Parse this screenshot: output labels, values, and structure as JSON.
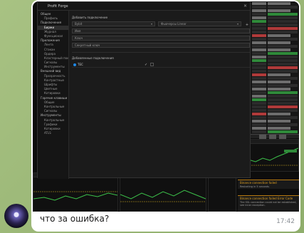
{
  "dialog": {
    "title": "Profit Forge",
    "nav": [
      {
        "label": "Общее",
        "level": 0,
        "active": false
      },
      {
        "label": "Профиль",
        "level": 1,
        "active": false
      },
      {
        "label": "Подключения",
        "level": 0,
        "active": false
      },
      {
        "label": "Биржи",
        "level": 1,
        "active": true
      },
      {
        "label": "Журнал",
        "level": 1,
        "active": false
      },
      {
        "label": "Функционал",
        "level": 1,
        "active": false
      },
      {
        "label": "Приложения",
        "level": 0,
        "active": false
      },
      {
        "label": "Лента",
        "level": 1,
        "active": false
      },
      {
        "label": "Стакан",
        "level": 1,
        "active": false
      },
      {
        "label": "Ордера",
        "level": 1,
        "active": false
      },
      {
        "label": "Кластерный поиск",
        "level": 1,
        "active": false
      },
      {
        "label": "Сигналы",
        "level": 1,
        "active": false
      },
      {
        "label": "Инструменты",
        "level": 1,
        "active": false
      },
      {
        "label": "Внешний вид",
        "level": 0,
        "active": false
      },
      {
        "label": "Прозрачность",
        "level": 1,
        "active": false
      },
      {
        "label": "Контрастные",
        "level": 1,
        "active": false
      },
      {
        "label": "Шрифты",
        "level": 1,
        "active": false
      },
      {
        "label": "Цветные",
        "level": 1,
        "active": false
      },
      {
        "label": "Котировки",
        "level": 1,
        "active": false
      },
      {
        "label": "Горячие клавиши",
        "level": 0,
        "active": false
      },
      {
        "label": "Общие",
        "level": 1,
        "active": false
      },
      {
        "label": "Контрольные",
        "level": 1,
        "active": false
      },
      {
        "label": "Сигналы",
        "level": 1,
        "active": false
      },
      {
        "label": "Инструменты",
        "level": 0,
        "active": false
      },
      {
        "label": "Контрольные",
        "level": 1,
        "active": false
      },
      {
        "label": "Графики",
        "level": 1,
        "active": false
      },
      {
        "label": "Котировки",
        "level": 1,
        "active": false
      },
      {
        "label": "ATLS",
        "level": 1,
        "active": false
      }
    ],
    "add_section_label": "Добавить подключение",
    "exchange_select": "Bybit",
    "market_select": "Фьючерсы Linear",
    "name_field": "Имя",
    "key_field": "Ключ",
    "secret_field": "Секретный ключ",
    "plus_label": "+",
    "added_section_label": "Добавленные подключения",
    "connections": [
      {
        "name": "ТЕС",
        "enabled": true
      }
    ]
  },
  "notifications": [
    {
      "title": "Binance connection failed",
      "message": "Restarting in 5 seconds"
    },
    {
      "title": "Binance connection failed Error Code",
      "message": "The SSL connection could not be established, see inner exception."
    }
  ],
  "message": {
    "caption": "что за ошибка?",
    "time": "17:42"
  },
  "colors": {
    "accent": "#1e88e5",
    "warning": "#e0a020",
    "wallpaper": "#9bb87a"
  }
}
